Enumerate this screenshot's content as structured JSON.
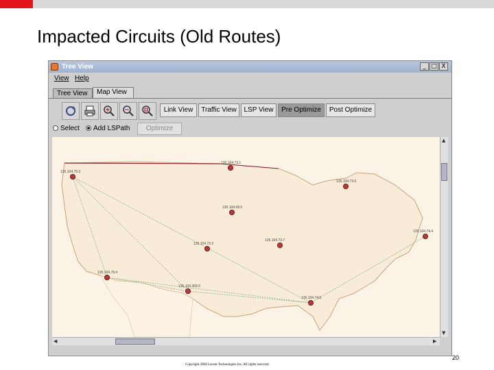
{
  "slide": {
    "title": "Impacted Circuits (Old Routes)",
    "page_number": "20",
    "copyright": "Copyright 2004 Lucent Technologies Inc. All rights reserved."
  },
  "window": {
    "title": "Tree View",
    "controls": [
      "_",
      "□",
      "X"
    ]
  },
  "menu": [
    "View",
    "Help"
  ],
  "tabs": [
    {
      "label": "Tree View",
      "active": false
    },
    {
      "label": "Map View",
      "active": true
    }
  ],
  "toolbar": {
    "icons": [
      "refresh-icon",
      "print-icon",
      "zoom-in-icon",
      "zoom-out-icon",
      "zoom-fit-icon"
    ],
    "view_buttons": [
      {
        "label": "Link View",
        "active": false
      },
      {
        "label": "Traffic View",
        "active": false
      },
      {
        "label": "LSP View",
        "active": false
      },
      {
        "label": "Pre Optimize",
        "active": true
      },
      {
        "label": "Post Optimize",
        "active": false
      }
    ]
  },
  "mode": {
    "select_label": "Select",
    "add_lspath_label": "Add LSPath",
    "selected": "Add LSPath",
    "optimize_label": "Optimize",
    "optimize_enabled": false
  },
  "map": {
    "land_color": "#f8ecd8",
    "border_color": "#8b1c2c",
    "route_color": "#8db88a",
    "node_color": "#b53a3a",
    "nodes": [
      {
        "label": "135.104.79.3"
      },
      {
        "label": "135.104.73.1"
      },
      {
        "label": "135.104.68.0"
      },
      {
        "label": "135.104.73.6"
      },
      {
        "label": "135.104.72.2"
      },
      {
        "label": "135.104.73.7"
      },
      {
        "label": "135.104.74.4"
      },
      {
        "label": "135.104.78.4"
      },
      {
        "label": "135.104.369.5"
      },
      {
        "label": "135.104.74.5"
      }
    ]
  }
}
